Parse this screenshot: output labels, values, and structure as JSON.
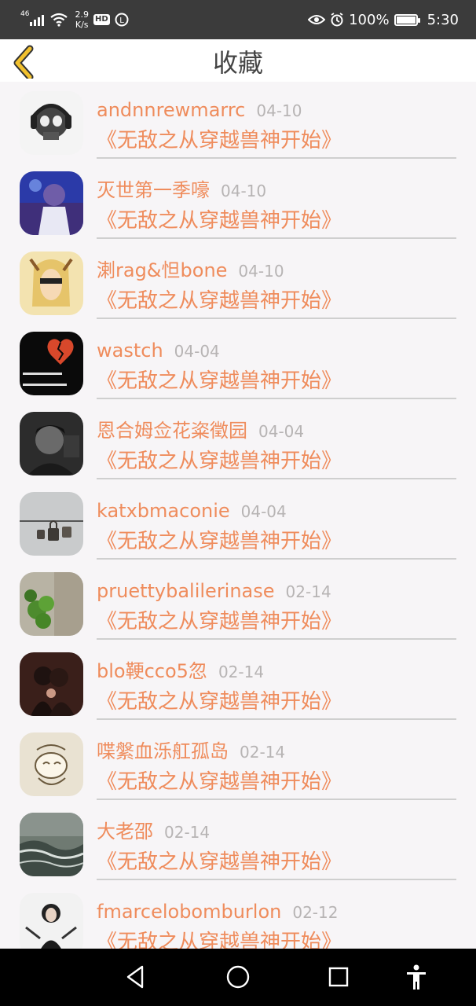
{
  "status_bar": {
    "signal_label": "46",
    "speed_value": "2.9",
    "speed_unit": "K/s",
    "hd_label": "HD",
    "battery_text": "100%",
    "time": "5:30"
  },
  "header": {
    "title": "收藏",
    "back_icon": "chevron-left-icon",
    "accent_color": "#f2c12e"
  },
  "colors": {
    "name_color": "#ef8c5c",
    "date_color": "#b7b4b4",
    "divider": "#cfcfcf"
  },
  "favorites": [
    {
      "name": "andnnrewmarrc",
      "date": "04-10",
      "book": "《无敌之从穿越兽神开始》"
    },
    {
      "name": "灭世第一季嚎",
      "date": "04-10",
      "book": "《无敌之从穿越兽神开始》"
    },
    {
      "name": "溂rag&怛bone",
      "date": "04-10",
      "book": "《无敌之从穿越兽神开始》"
    },
    {
      "name": "wastch",
      "date": "04-04",
      "book": "《无敌之从穿越兽神开始》"
    },
    {
      "name": "恩合姆佥花粢徵园",
      "date": "04-04",
      "book": "《无敌之从穿越兽神开始》"
    },
    {
      "name": "katxbmaconie",
      "date": "04-04",
      "book": "《无敌之从穿越兽神开始》"
    },
    {
      "name": "pruettybalilerinase",
      "date": "02-14",
      "book": "《无敌之从穿越兽神开始》"
    },
    {
      "name": "blo鞕cco5忽",
      "date": "02-14",
      "book": "《无敌之从穿越兽神开始》"
    },
    {
      "name": "喋縏血泺舡孤岛",
      "date": "02-14",
      "book": "《无敌之从穿越兽神开始》"
    },
    {
      "name": "大老邵",
      "date": "02-14",
      "book": "《无敌之从穿越兽神开始》"
    },
    {
      "name": "fmarcelobomburlon",
      "date": "02-12",
      "book": "《无敌之从穿越兽神开始》"
    }
  ],
  "nav_bar": {
    "back": "triangle-back-icon",
    "home": "circle-home-icon",
    "recents": "square-recents-icon",
    "accessibility": "accessibility-icon"
  }
}
